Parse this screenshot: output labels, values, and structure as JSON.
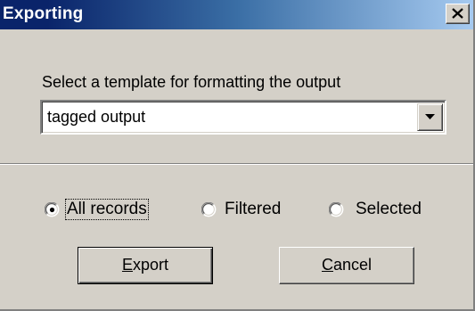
{
  "window": {
    "title": "Exporting",
    "close_symbol": "×"
  },
  "template": {
    "prompt": "Select a template for formatting the output",
    "selected_value": "tagged output"
  },
  "scope": {
    "options": [
      {
        "label": "All records",
        "selected": true
      },
      {
        "label": "Filtered",
        "selected": false
      },
      {
        "label": "Selected",
        "selected": false
      }
    ]
  },
  "buttons": {
    "export_mnemonic": "E",
    "export_rest": "xport",
    "cancel_mnemonic": "C",
    "cancel_rest": "ancel"
  },
  "colors": {
    "titlebar_start": "#0a246a",
    "titlebar_end": "#a6caf0",
    "face": "#d4d0c8"
  }
}
